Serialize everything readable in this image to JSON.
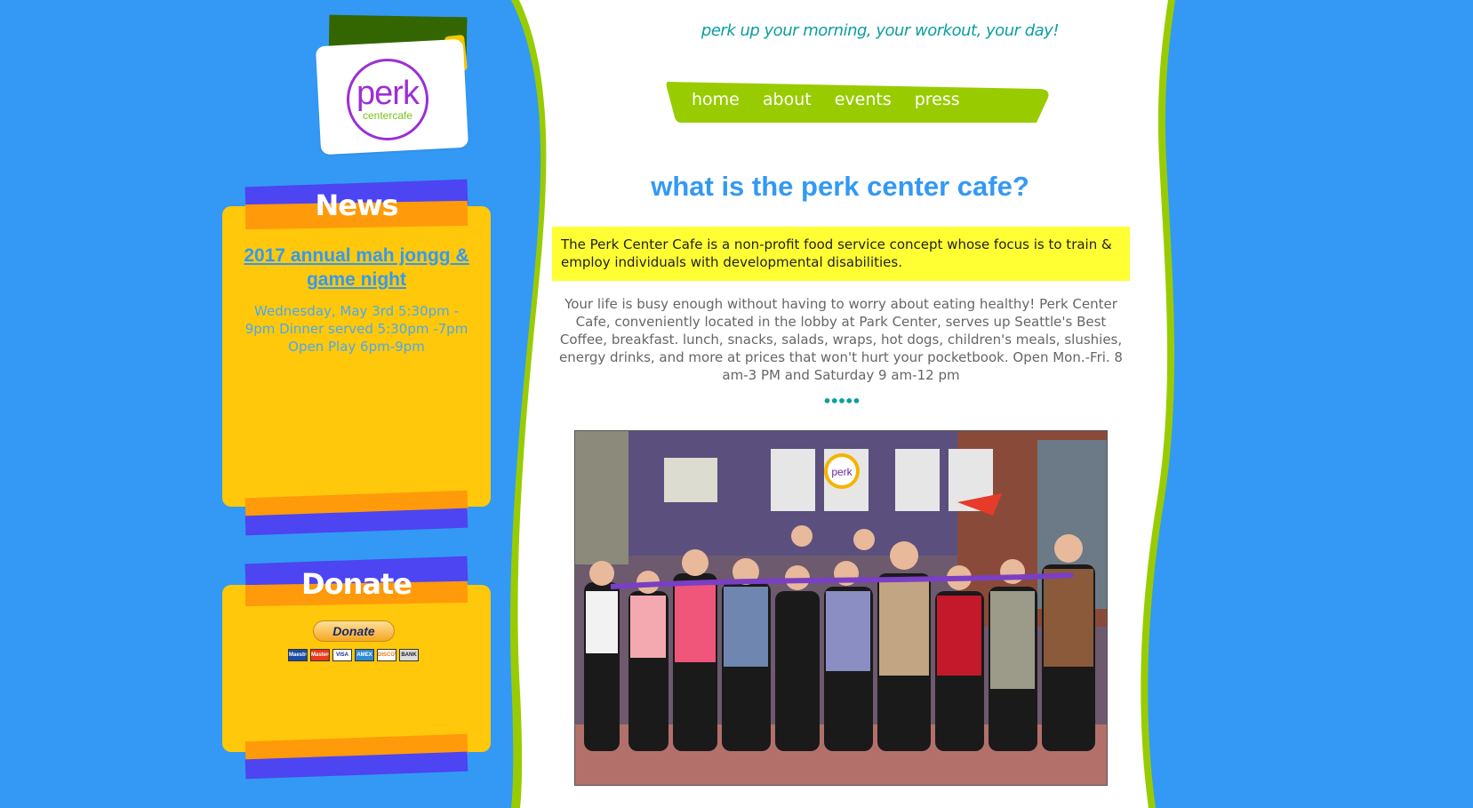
{
  "brand": {
    "logo_word": "perk",
    "logo_sub": "centercafe",
    "tagline": "perk up your morning, your workout, your day!"
  },
  "nav": {
    "items": [
      "home",
      "about",
      "events",
      "press"
    ]
  },
  "news": {
    "title": "News",
    "event_title": "2017 annual mah jongg & game night",
    "event_details": "Wednesday, May 3rd 5:30pm - 9pm Dinner served 5:30pm -7pm Open Play 6pm-9pm"
  },
  "donate": {
    "title": "Donate",
    "button_label": "Donate",
    "cards": [
      "Maestro",
      "MasterCard",
      "VISA",
      "AMEX",
      "DISCOVER",
      "BANK"
    ]
  },
  "main": {
    "heading": "what is the perk center cafe?",
    "intro": "The Perk Center Cafe is a non-profit food service concept whose focus is to train & employ individuals with developmental disabilities.",
    "body": "Your life is busy enough without having to worry about eating healthy! Perk Center Cafe, conveniently located in the lobby at Park Center, serves up Seattle's Best Coffee, breakfast. lunch, snacks, salads, wraps, hot dogs, children's meals, slushies, energy drinks, and more at prices that won't hurt your pocketbook. Open Mon.-Fri. 8 am-3 PM and Saturday 9 am-12 pm",
    "divider": "•••••",
    "photo_sign": "perk"
  },
  "colors": {
    "background": "#3399f5",
    "lime": "#99cc00",
    "yellow_box": "#ffc80a",
    "purple_ribbon": "#4d44f2",
    "orange_ribbon": "#ff9a0a",
    "highlight": "#ffff33",
    "teal": "#0c9ea0"
  }
}
